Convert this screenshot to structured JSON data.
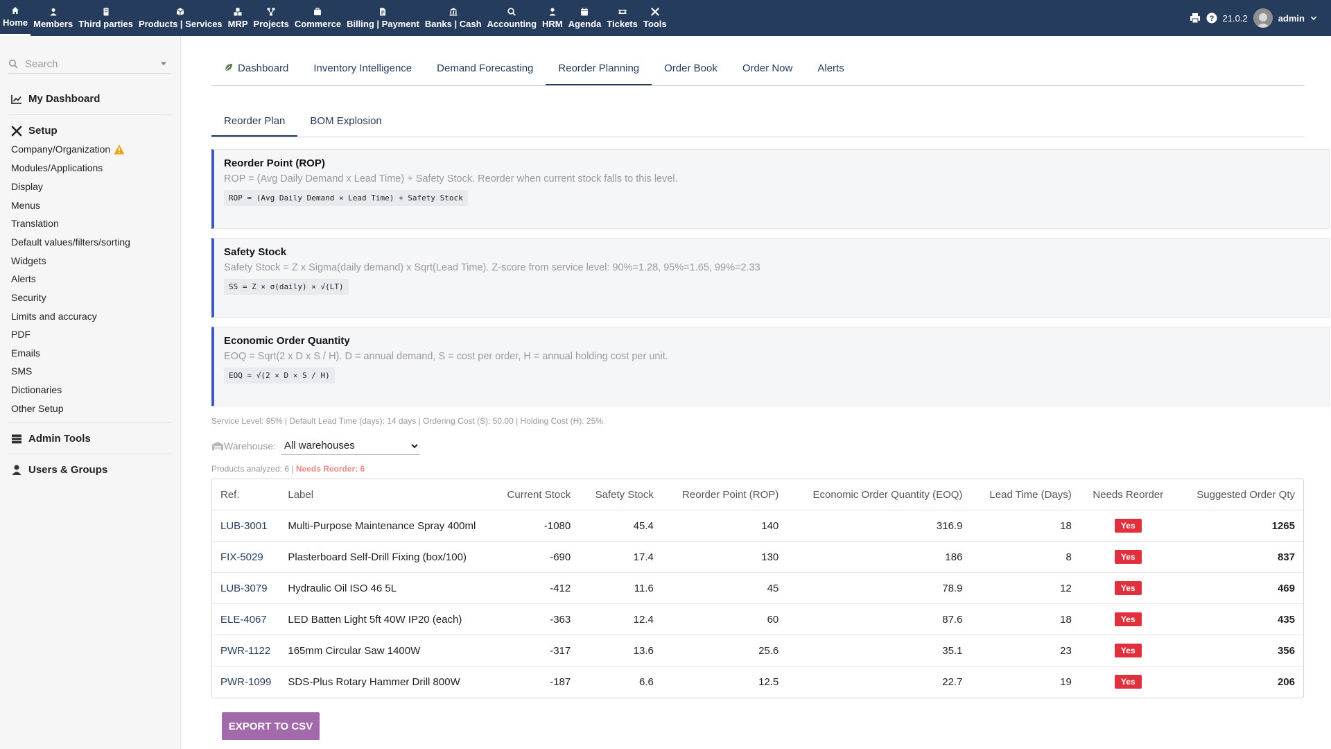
{
  "topnav": [
    {
      "label": "Home",
      "icon": "home-icon",
      "active": true
    },
    {
      "label": "Members",
      "icon": "user-icon"
    },
    {
      "label": "Third parties",
      "icon": "building-icon"
    },
    {
      "label": "Products | Services",
      "icon": "cube-icon"
    },
    {
      "label": "MRP",
      "icon": "cubes-icon"
    },
    {
      "label": "Projects",
      "icon": "sitemap-icon"
    },
    {
      "label": "Commerce",
      "icon": "briefcase-icon"
    },
    {
      "label": "Billing | Payment",
      "icon": "file-invoice-icon"
    },
    {
      "label": "Banks | Cash",
      "icon": "bank-icon"
    },
    {
      "label": "Accounting",
      "icon": "search-dollar-icon"
    },
    {
      "label": "HRM",
      "icon": "user-tie-icon"
    },
    {
      "label": "Agenda",
      "icon": "calendar-icon"
    },
    {
      "label": "Tickets",
      "icon": "ticket-icon"
    },
    {
      "label": "Tools",
      "icon": "tools-icon"
    }
  ],
  "topright": {
    "version": "21.0.2",
    "user": "admin"
  },
  "sidebar": {
    "search_placeholder": "Search",
    "my_dashboard": "My Dashboard",
    "setup": "Setup",
    "setup_items": [
      "Company/Organization",
      "Modules/Applications",
      "Display",
      "Menus",
      "Translation",
      "Default values/filters/sorting",
      "Widgets",
      "Alerts",
      "Security",
      "Limits and accuracy",
      "PDF",
      "Emails",
      "SMS",
      "Dictionaries",
      "Other Setup"
    ],
    "admin_tools": "Admin Tools",
    "users_groups": "Users & Groups"
  },
  "tabs": [
    {
      "label": "Dashboard"
    },
    {
      "label": "Inventory Intelligence"
    },
    {
      "label": "Demand Forecasting"
    },
    {
      "label": "Reorder Planning",
      "active": true
    },
    {
      "label": "Order Book"
    },
    {
      "label": "Order Now"
    },
    {
      "label": "Alerts"
    }
  ],
  "subtabs": [
    {
      "label": "Reorder Plan",
      "active": true
    },
    {
      "label": "BOM Explosion"
    }
  ],
  "info_boxes": [
    {
      "title": "Reorder Point (ROP)",
      "desc": "ROP = (Avg Daily Demand x Lead Time) + Safety Stock. Reorder when current stock falls to this level.",
      "formula": "ROP = (Avg Daily Demand × Lead Time) + Safety Stock"
    },
    {
      "title": "Safety Stock",
      "desc": "Safety Stock = Z x Sigma(daily demand) x Sqrt(Lead Time). Z-score from service level: 90%=1.28, 95%=1.65, 99%=2.33",
      "formula": "SS = Z × σ(daily) × √(LT)"
    },
    {
      "title": "Economic Order Quantity",
      "desc": "EOQ = Sqrt(2 x D x S / H). D = annual demand, S = cost per order, H = annual holding cost per unit.",
      "formula": "EOQ = √(2 × D × S / H)"
    }
  ],
  "params_line": "Service Level: 95% | Default Lead Time (days): 14 days | Ordering Cost (S): 50.00 | Holding Cost (H): 25%",
  "warehouse": {
    "label": "Warehouse:",
    "selected": "All warehouses"
  },
  "analyzed": {
    "text": "Products analyzed: 6 | ",
    "needs": "Needs Reorder: 6"
  },
  "table": {
    "headers": [
      "Ref.",
      "Label",
      "Current Stock",
      "Safety Stock",
      "Reorder Point (ROP)",
      "Economic Order Quantity (EOQ)",
      "Lead Time (Days)",
      "Needs Reorder",
      "Suggested Order Qty"
    ],
    "rows": [
      {
        "ref": "LUB-3001",
        "label": "Multi-Purpose Maintenance Spray 400ml",
        "stock": "-1080",
        "safety": "45.4",
        "rop": "140",
        "eoq": "316.9",
        "lead": "18",
        "needs": "Yes",
        "qty": "1265"
      },
      {
        "ref": "FIX-5029",
        "label": "Plasterboard Self-Drill Fixing (box/100)",
        "stock": "-690",
        "safety": "17.4",
        "rop": "130",
        "eoq": "186",
        "lead": "8",
        "needs": "Yes",
        "qty": "837"
      },
      {
        "ref": "LUB-3079",
        "label": "Hydraulic Oil ISO 46 5L",
        "stock": "-412",
        "safety": "11.6",
        "rop": "45",
        "eoq": "78.9",
        "lead": "12",
        "needs": "Yes",
        "qty": "469"
      },
      {
        "ref": "ELE-4067",
        "label": "LED Batten Light 5ft 40W IP20 (each)",
        "stock": "-363",
        "safety": "12.4",
        "rop": "60",
        "eoq": "87.6",
        "lead": "18",
        "needs": "Yes",
        "qty": "435"
      },
      {
        "ref": "PWR-1122",
        "label": "165mm Circular Saw 1400W",
        "stock": "-317",
        "safety": "13.6",
        "rop": "25.6",
        "eoq": "35.1",
        "lead": "23",
        "needs": "Yes",
        "qty": "356"
      },
      {
        "ref": "PWR-1099",
        "label": "SDS-Plus Rotary Hammer Drill 800W",
        "stock": "-187",
        "safety": "6.6",
        "rop": "12.5",
        "eoq": "22.7",
        "lead": "19",
        "needs": "Yes",
        "qty": "206"
      }
    ]
  },
  "export_label": "EXPORT TO CSV",
  "colors": {
    "topbar": "#263c5c",
    "accent": "#3b5bbd",
    "badge": "#e0303d",
    "export": "#a26aaa",
    "warning": "#e8a317"
  }
}
